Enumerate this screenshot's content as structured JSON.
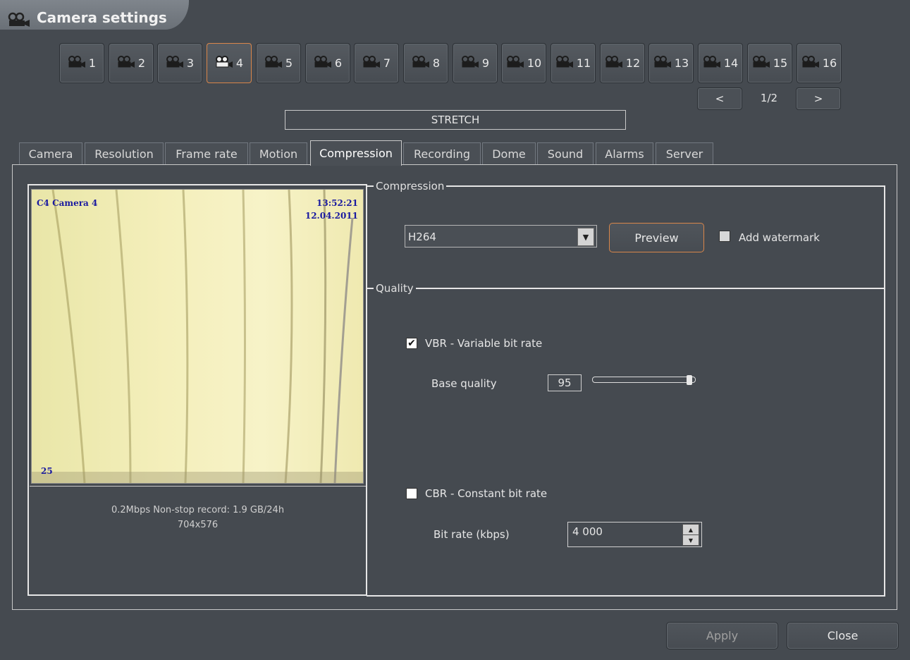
{
  "window": {
    "title": "Camera settings"
  },
  "cameras": [
    {
      "label": "1"
    },
    {
      "label": "2"
    },
    {
      "label": "3"
    },
    {
      "label": "4"
    },
    {
      "label": "5"
    },
    {
      "label": "6"
    },
    {
      "label": "7"
    },
    {
      "label": "8"
    },
    {
      "label": "9"
    },
    {
      "label": "10"
    },
    {
      "label": "11"
    },
    {
      "label": "12"
    },
    {
      "label": "13"
    },
    {
      "label": "14"
    },
    {
      "label": "15"
    },
    {
      "label": "16"
    }
  ],
  "active_camera": "4",
  "pager": {
    "prev": "<",
    "page": "1/2",
    "next": ">"
  },
  "stretch_label": "STRETCH",
  "tabs": [
    "Camera",
    "Resolution",
    "Frame rate",
    "Motion",
    "Compression",
    "Recording",
    "Dome",
    "Sound",
    "Alarms",
    "Server"
  ],
  "active_tab": "Compression",
  "preview": {
    "camera_name": "C4 Camera 4",
    "time": "13:52:21",
    "date": "12.04.2011",
    "fps": "25",
    "stats_line1": "0.2Mbps  Non-stop record: 1.9 GB/24h",
    "stats_line2": "704x576"
  },
  "compression": {
    "group_label": "Compression",
    "codec": "H264",
    "preview_button": "Preview",
    "watermark_label": "Add watermark",
    "watermark_checked": false
  },
  "quality": {
    "group_label": "Quality",
    "vbr_label": "VBR - Variable bit rate",
    "vbr_checked": true,
    "base_quality_label": "Base quality",
    "base_quality_value": "95",
    "base_quality_level": 0.95,
    "cbr_label": "CBR - Constant bit rate",
    "cbr_checked": false,
    "bitrate_label": "Bit rate (kbps)",
    "bitrate_value": "4 000"
  },
  "footer": {
    "apply": "Apply",
    "close": "Close"
  },
  "colors": {
    "background": "#454a50",
    "accent": "#d9864a"
  }
}
